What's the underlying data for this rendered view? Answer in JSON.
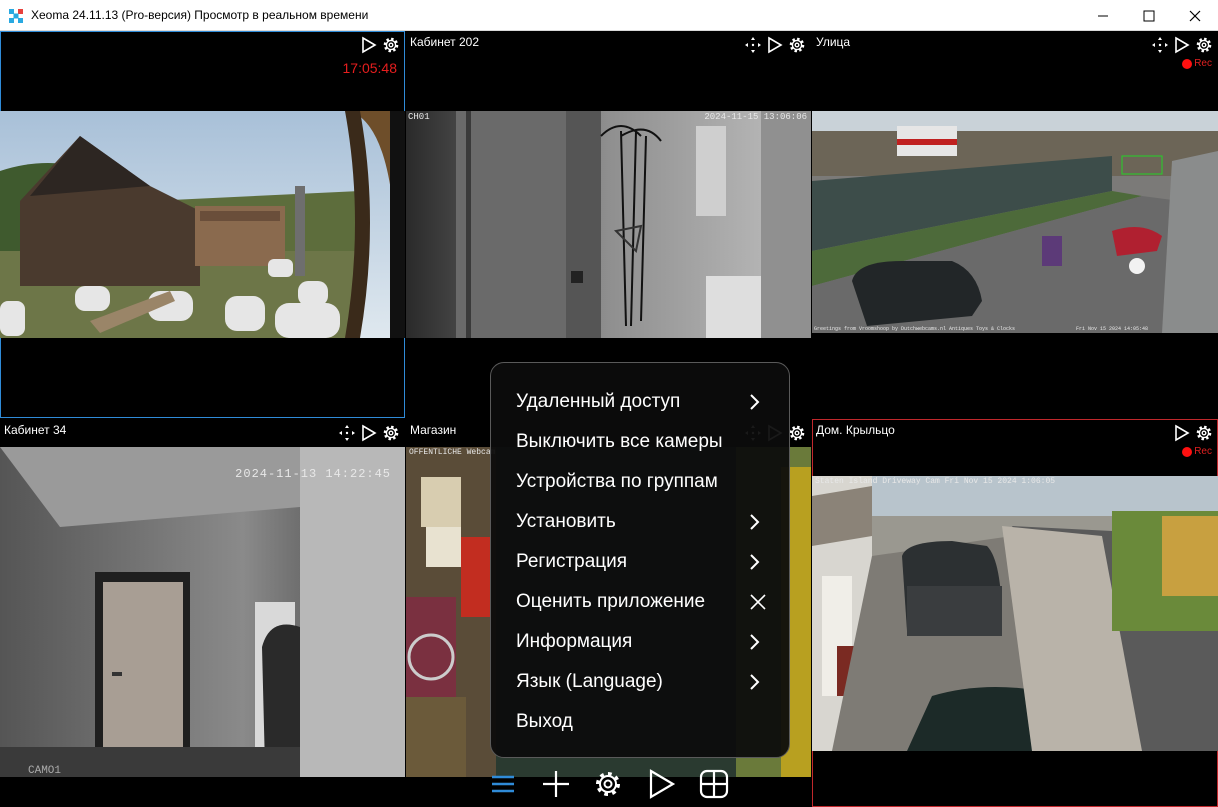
{
  "window": {
    "title": "Xeoma 24.11.13 (Pro-версия) Просмотр в реальном времени"
  },
  "cameras": [
    {
      "name": "",
      "clock": "17:05:48"
    },
    {
      "name": "Кабинет 202",
      "overlay_left": "CH01",
      "overlay_right": "2024-11-15 13:06:06"
    },
    {
      "name": "Улица",
      "rec": "Rec",
      "overlay_bottom_left": "Greetings from Vroomshoop by Dutchwebcams.nl Antiques Toys & Clocks",
      "overlay_bottom_right": "Fri Nov 15 2024 14:05:48"
    },
    {
      "name": "Кабинет 34",
      "overlay_top": "2024-11-13 14:22:45",
      "overlay_bottom": "CAMO1"
    },
    {
      "name": "Магазин",
      "overlay_top": "OFFENTLICHE Webcam"
    },
    {
      "name": "Дом. Крыльцо",
      "rec": "Rec",
      "overlay_top": "Staten Island Driveway Cam Fri Nov 15 2024 1:06:05"
    }
  ],
  "menu": {
    "items": [
      {
        "label": "Удаленный доступ",
        "icon": "chevron-right-icon"
      },
      {
        "label": "Выключить все камеры",
        "icon": ""
      },
      {
        "label": "Устройства по группам",
        "icon": ""
      },
      {
        "label": "Установить",
        "icon": "chevron-right-icon"
      },
      {
        "label": "Регистрация",
        "icon": "chevron-right-icon"
      },
      {
        "label": "Оценить приложение",
        "icon": "close-icon"
      },
      {
        "label": "Информация",
        "icon": "chevron-right-icon"
      },
      {
        "label": "Язык (Language)",
        "icon": "chevron-right-icon"
      },
      {
        "label": "Выход",
        "icon": ""
      }
    ]
  },
  "toolbar": {
    "buttons": [
      "menu-icon",
      "add-icon",
      "settings-icon",
      "play-icon",
      "layout-grid-icon"
    ]
  },
  "colors": {
    "accent": "#2f8bd8",
    "rec": "#ff1010",
    "clock": "#e61e1e",
    "selected_red": "#c0282c"
  }
}
